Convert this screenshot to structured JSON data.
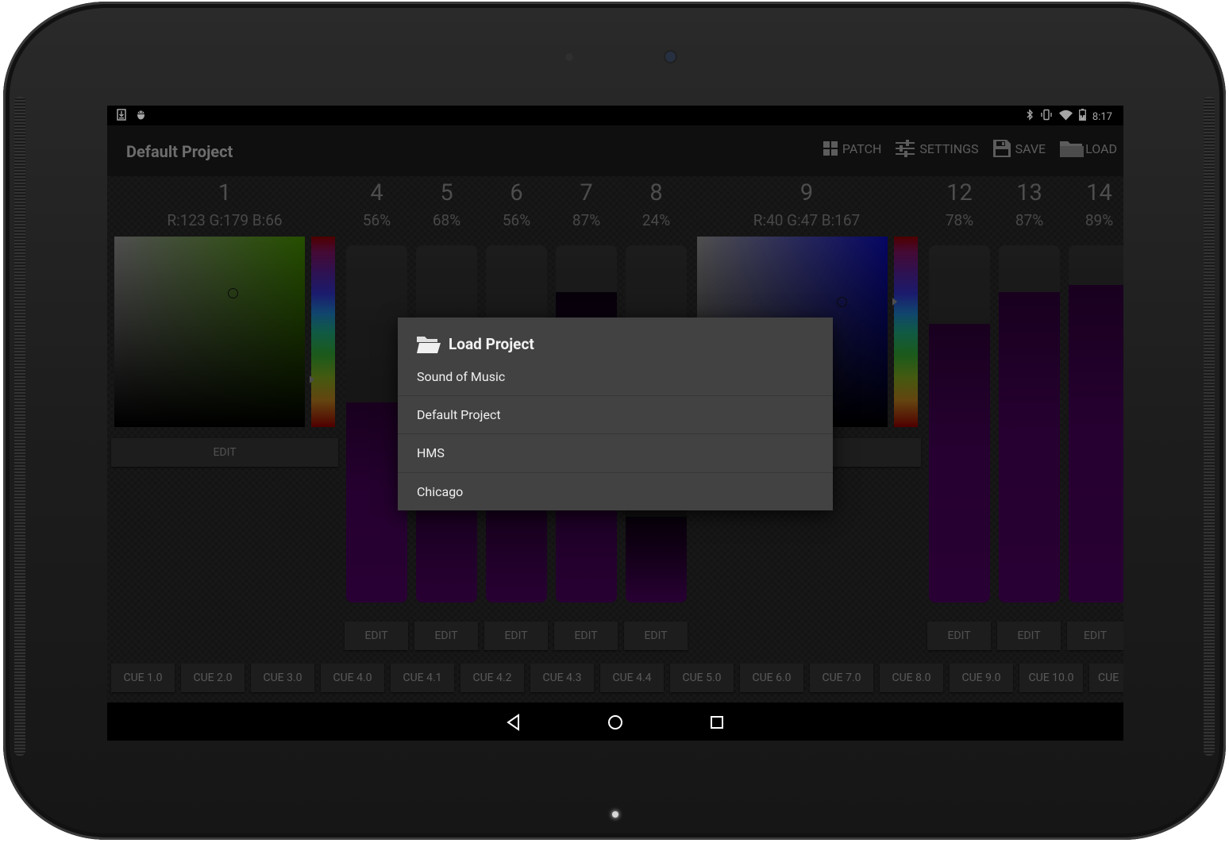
{
  "status_bar": {
    "left_icons": [
      "download-icon",
      "android-debug-icon"
    ],
    "right_icons": [
      "bluetooth-icon",
      "vibrate-icon",
      "wifi-icon",
      "battery-charging-icon"
    ],
    "time": "8:17"
  },
  "action_bar": {
    "title": "Default Project",
    "actions": [
      {
        "label": "PATCH",
        "icon": "grid-icon"
      },
      {
        "label": "SETTINGS",
        "icon": "sliders-icon"
      },
      {
        "label": "SAVE",
        "icon": "floppy-disk-icon"
      },
      {
        "label": "LOAD",
        "icon": "folder-icon"
      }
    ]
  },
  "channels": [
    {
      "number": "1",
      "value": "R:123 G:179 B:66",
      "kind": "color",
      "color": "#3a7a00",
      "edit": "EDIT"
    },
    {
      "number": "4",
      "value": "56%",
      "kind": "fader",
      "level": 0.56,
      "edit": "EDIT"
    },
    {
      "number": "5",
      "value": "68%",
      "kind": "fader",
      "level": 0.68,
      "edit": "EDIT"
    },
    {
      "number": "6",
      "value": "56%",
      "kind": "fader",
      "level": 0.56,
      "edit": "EDIT"
    },
    {
      "number": "7",
      "value": "87%",
      "kind": "fader",
      "level": 0.87,
      "edit": "EDIT"
    },
    {
      "number": "8",
      "value": "24%",
      "kind": "fader",
      "level": 0.24,
      "edit": "EDIT"
    },
    {
      "number": "9",
      "value": "R:40 G:47 B:167",
      "kind": "color",
      "color": "#0a0a8a",
      "edit": "EDIT"
    },
    {
      "number": "12",
      "value": "78%",
      "kind": "fader",
      "level": 0.78,
      "edit": "EDIT"
    },
    {
      "number": "13",
      "value": "87%",
      "kind": "fader",
      "level": 0.87,
      "edit": "EDIT"
    },
    {
      "number": "14",
      "value": "89%",
      "kind": "fader",
      "level": 0.89,
      "edit": "EDIT"
    }
  ],
  "cues": [
    "CUE 1.0",
    "CUE 2.0",
    "CUE 3.0",
    "CUE 4.0",
    "CUE 4.1",
    "CUE 4.2",
    "CUE 4.3",
    "CUE 4.4",
    "CUE 5.0",
    "CUE 6.0",
    "CUE 7.0",
    "CUE 8.0",
    "CUE 9.0",
    "CUE 10.0",
    "CUE"
  ],
  "dialog": {
    "title": "Load Project",
    "icon": "folder-open-icon",
    "items": [
      "Sound of Music",
      "Default Project",
      "HMS",
      "Chicago"
    ]
  },
  "nav_bar": [
    "back-icon",
    "home-icon",
    "recents-icon"
  ],
  "colors": {
    "fader_fill": "#3f0050",
    "dialog_bg": "#424242",
    "action_bar_bg": "#181818"
  }
}
